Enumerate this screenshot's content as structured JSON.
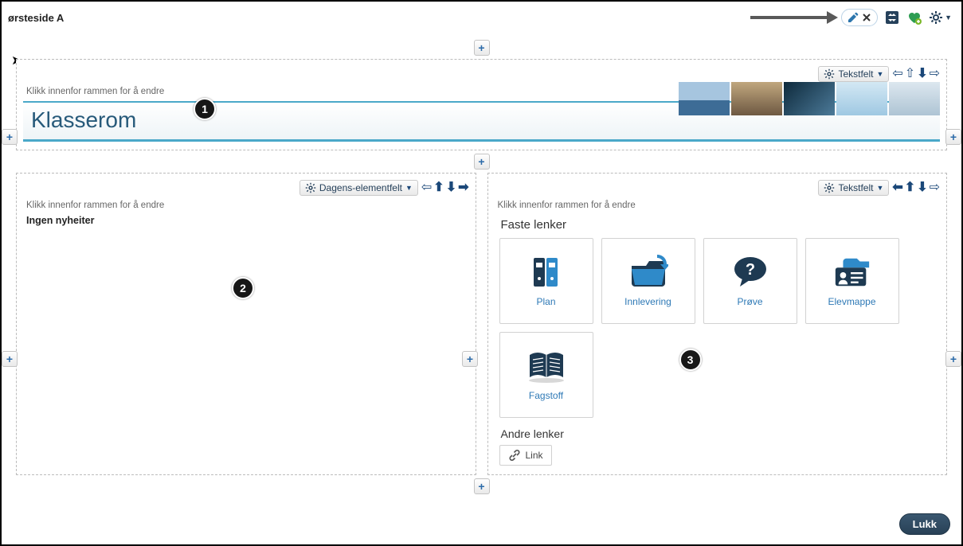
{
  "page_title": "ørsteside A",
  "block_hint": "Klikk innenfor rammen for å endre",
  "hero": {
    "title": "Klasserom",
    "dropdown": "Tekstfelt"
  },
  "news": {
    "dropdown": "Dagens-elementfelt",
    "content": "Ingen nyheiter"
  },
  "links": {
    "dropdown": "Tekstfelt",
    "section1_title": "Faste lenker",
    "tiles": [
      {
        "label": "Plan"
      },
      {
        "label": "Innlevering"
      },
      {
        "label": "Prøve"
      },
      {
        "label": "Elevmappe"
      },
      {
        "label": "Fagstoff"
      }
    ],
    "section2_title": "Andre lenker",
    "other_link": "Link"
  },
  "close_label": "Lukk",
  "badges": [
    "1",
    "2",
    "3"
  ]
}
